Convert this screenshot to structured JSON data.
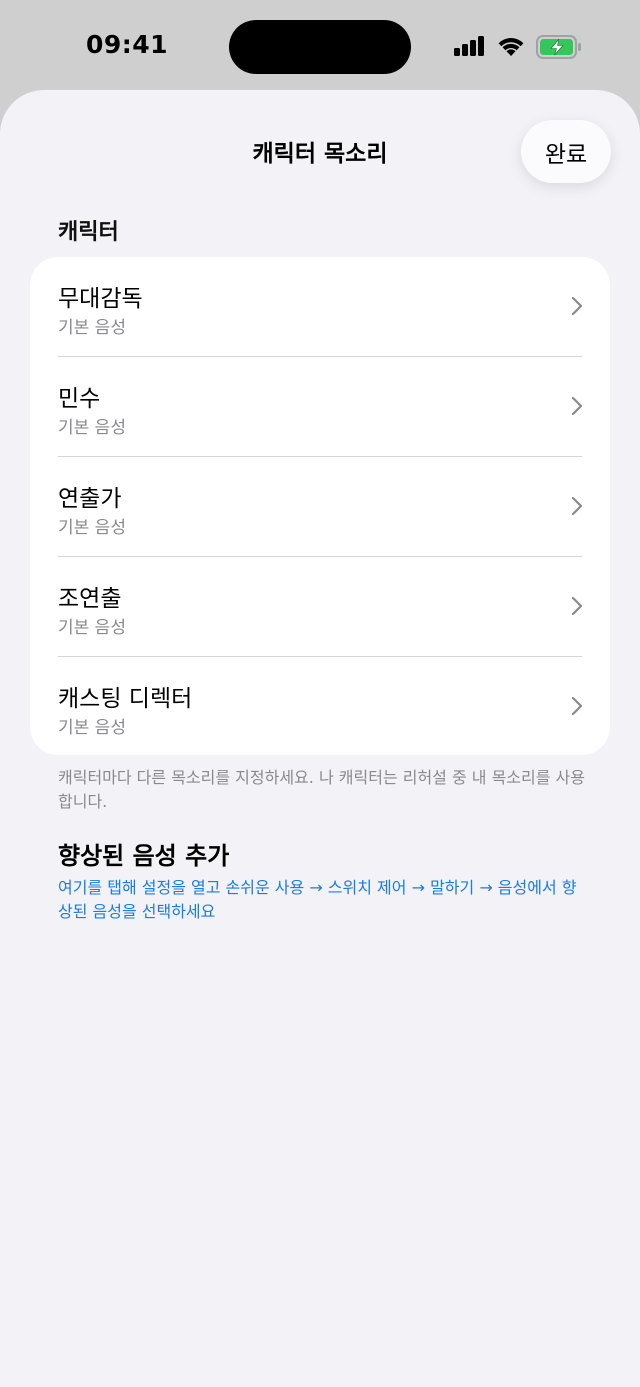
{
  "status_bar": {
    "time": "09:41"
  },
  "sheet": {
    "title": "캐릭터 목소리",
    "done_label": "완료"
  },
  "section": {
    "label": "캐릭터"
  },
  "characters": [
    {
      "name": "무대감독",
      "voice": "기본 음성"
    },
    {
      "name": "민수",
      "voice": "기본 음성"
    },
    {
      "name": "연출가",
      "voice": "기본 음성"
    },
    {
      "name": "조연출",
      "voice": "기본 음성"
    },
    {
      "name": "캐스팅 디렉터",
      "voice": "기본 음성"
    }
  ],
  "footnote": "캐릭터마다 다른 목소리를 지정하세요. 나 캐릭터는 리허설 중 내 목소리를 사용합니다.",
  "enhanced": {
    "title": "향상된 음성 추가",
    "link_text": "여기를 탭해 설정을 열고 손쉬운 사용 → 스위치 제어 → 말하기 → 음성에서 향상된 음성을 선택하세요"
  },
  "colors": {
    "accent": "#1b7ce8",
    "sheet_background": "#f2f2f7",
    "battery_fill": "#34c759"
  },
  "icons": {
    "signal": "cellular-signal-icon",
    "wifi": "wifi-icon",
    "battery": "battery-charging-icon",
    "chevron": "chevron-right-icon"
  }
}
